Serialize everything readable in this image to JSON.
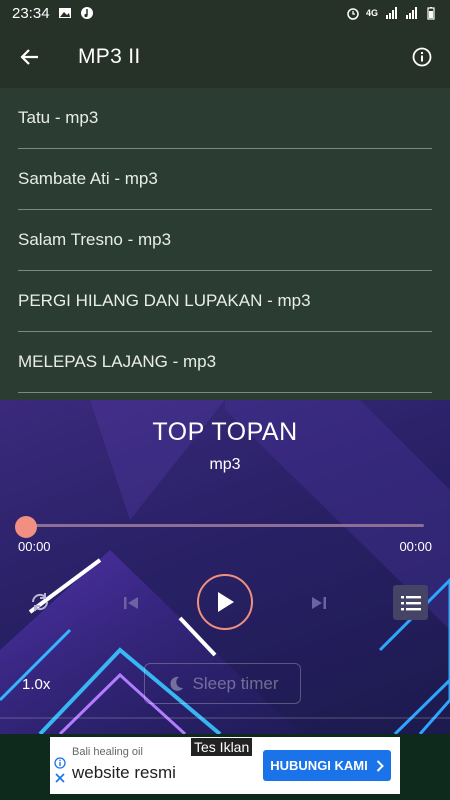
{
  "status_bar": {
    "time": "23:34",
    "network": "4G"
  },
  "app_bar": {
    "title": "MP3 II"
  },
  "songs": [
    {
      "label": "Tatu - mp3"
    },
    {
      "label": "Sambate Ati - mp3"
    },
    {
      "label": "Salam Tresno - mp3"
    },
    {
      "label": "PERGI HILANG DAN LUPAKAN - mp3"
    },
    {
      "label": "MELEPAS LAJANG - mp3"
    }
  ],
  "player": {
    "title": "TOP TOPAN",
    "subtitle": "mp3",
    "elapsed": "00:00",
    "duration": "00:00",
    "progress": 0,
    "speed": "1.0x",
    "sleep_timer": "Sleep timer"
  },
  "ad": {
    "tag": "Tes Iklan",
    "advertiser": "Bali healing oil",
    "headline": "website resmi",
    "cta": "HUBUNGI KAMI"
  },
  "colors": {
    "app_bar": "#263228",
    "list_bg": "#2b3d33",
    "accent": "#f18f82",
    "cta": "#1a73e8"
  }
}
